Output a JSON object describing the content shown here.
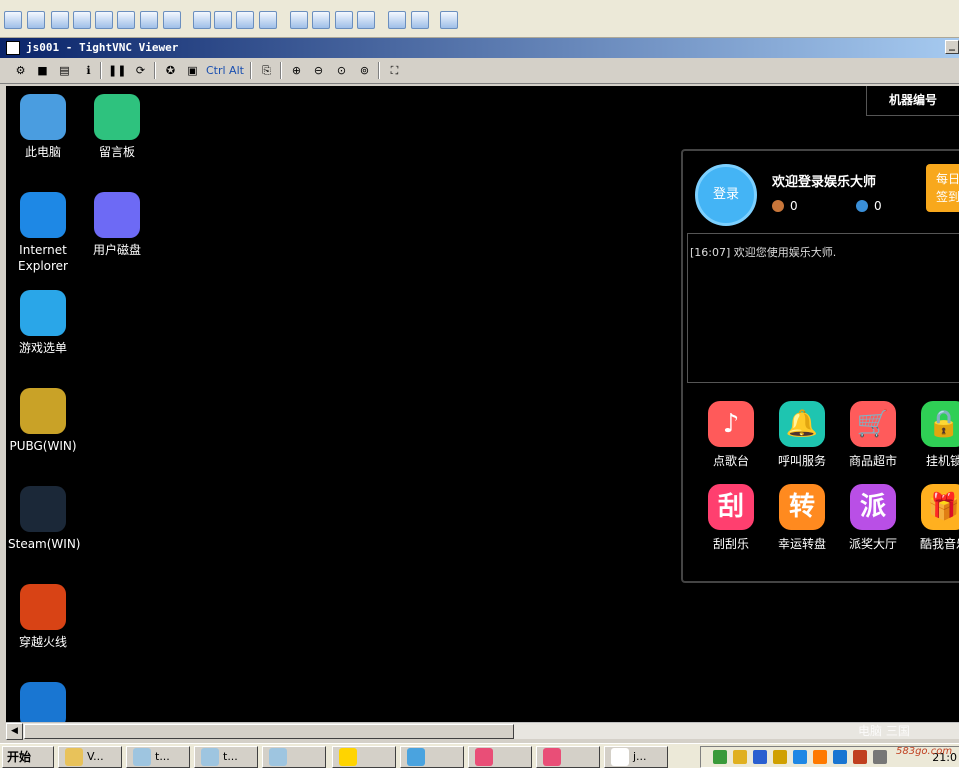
{
  "outer_toolbar": {
    "icons": [
      "window-icon",
      "screen-icon",
      "image-icon",
      "arrows-icon",
      "clock-icon",
      "chat-icon",
      "phone-icon",
      "message-icon",
      "hand-icon",
      "group-icon",
      "lock-icon",
      "lock-icon",
      "monitor-icon",
      "fullscreen-icon",
      "display-icon",
      "fit-icon",
      "copy-icon",
      "tools-icon",
      "close-icon"
    ]
  },
  "vnc": {
    "title": "js001 - TightVNC Viewer",
    "min_label": "_",
    "toolbar": {
      "ctrl_label": "Ctrl",
      "alt_label": "Alt"
    }
  },
  "desktop": {
    "icons": [
      {
        "label": "此电脑",
        "color": "#4a9de0"
      },
      {
        "label": "留言板",
        "color": "#2ec27e"
      },
      {
        "label": "Internet Explorer",
        "color": "#1e88e5"
      },
      {
        "label": "用户磁盘",
        "color": "#6d6af5"
      },
      {
        "label": "游戏选单",
        "color": "#2aa6e8"
      },
      {
        "label": "PUBG(WIN)",
        "color": "#c9a227"
      },
      {
        "label": "Steam(WIN)",
        "color": "#1b2838"
      },
      {
        "label": "穿越火线",
        "color": "#d84315"
      },
      {
        "label": "",
        "color": "#1976d2"
      }
    ],
    "machine_label": "机器编号"
  },
  "panel": {
    "login_label": "登录",
    "welcome": "欢迎登录娱乐大师",
    "coin1": "0",
    "coin2": "0",
    "checkin_line1": "每日",
    "checkin_line2": "签到",
    "message": "[16:07] 欢迎您使用娱乐大师.",
    "apps": [
      {
        "label": "点歌台",
        "glyph": "♪",
        "color": "#ff5a5a"
      },
      {
        "label": "呼叫服务",
        "glyph": "🔔",
        "color": "#1ec5b0"
      },
      {
        "label": "商品超市",
        "glyph": "🛒",
        "color": "#ff5b5b"
      },
      {
        "label": "挂机锁",
        "glyph": "🔒",
        "color": "#2fcf55"
      },
      {
        "label": "刮刮乐",
        "glyph": "刮",
        "color": "#ff3f6f"
      },
      {
        "label": "幸运转盘",
        "glyph": "转",
        "color": "#ff8a1f"
      },
      {
        "label": "派奖大厅",
        "glyph": "派",
        "color": "#b94fe6"
      },
      {
        "label": "酷我音乐",
        "glyph": "🎁",
        "color": "#ffb01f"
      }
    ]
  },
  "taskbar": {
    "start_label": "开始",
    "tasks": [
      {
        "label": "V...",
        "color": "#e8c25a"
      },
      {
        "label": "t...",
        "color": "#9ec5e0"
      },
      {
        "label": "t...",
        "color": "#9ec5e0"
      },
      {
        "label": "",
        "color": "#9ec5e0"
      },
      {
        "label": "",
        "color": "#ffd400"
      },
      {
        "label": "",
        "color": "#4aa3df"
      },
      {
        "label": "",
        "color": "#e94e77"
      },
      {
        "label": "",
        "color": "#e94e77"
      },
      {
        "label": "j...",
        "color": "#ffffff"
      }
    ],
    "clock": "21:0"
  },
  "watermark": {
    "text": "电脑 三国",
    "site": "583go.com"
  }
}
